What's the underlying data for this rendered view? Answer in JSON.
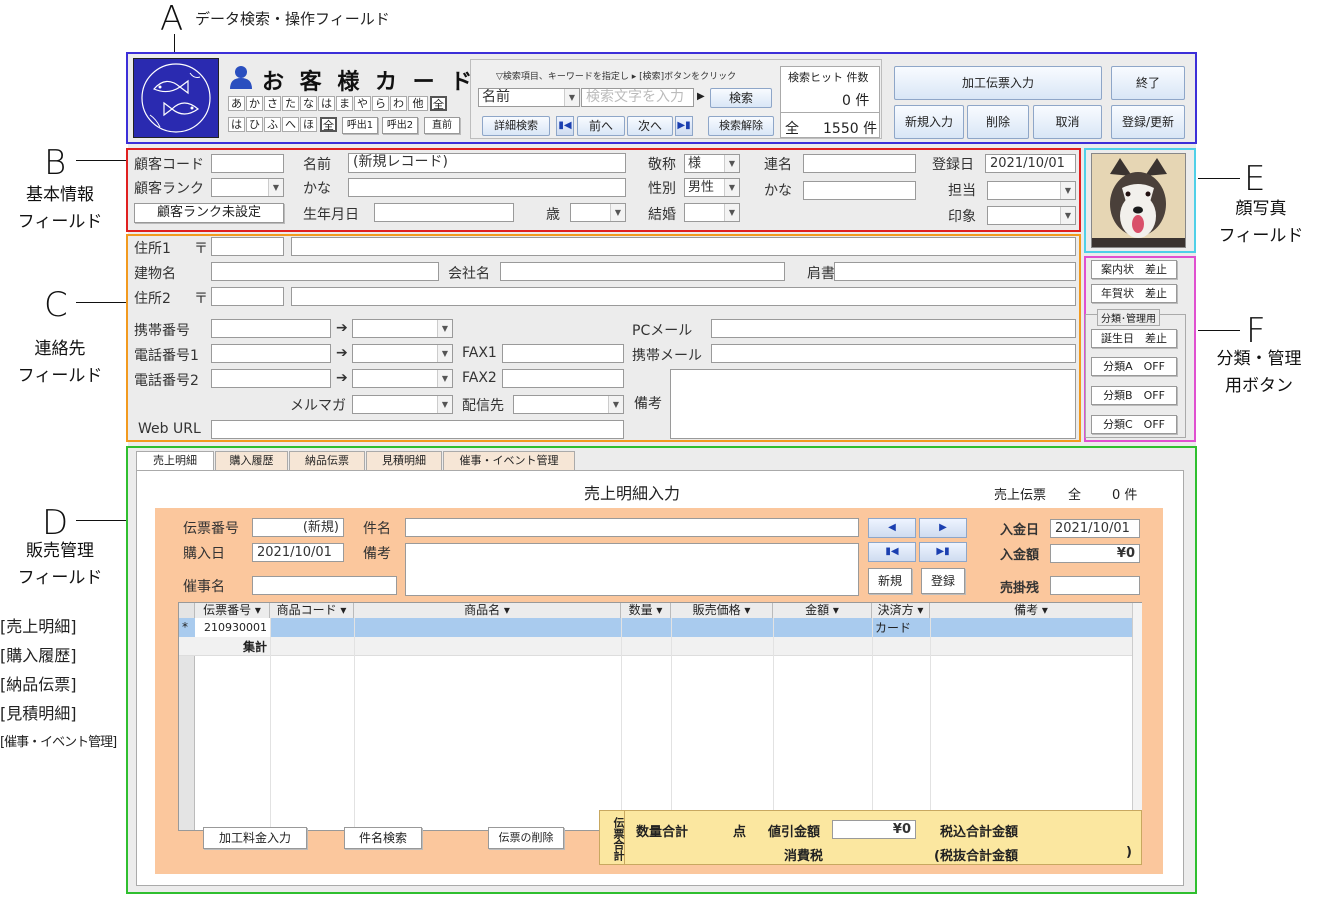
{
  "annotations": {
    "a_letter": "A",
    "a_text": "データ検索・操作フィールド",
    "b_letter": "B",
    "b_line1": "基本情報",
    "b_line2": "フィールド",
    "c_letter": "C",
    "c_line1": "連絡先",
    "c_line2": "フィールド",
    "d_letter": "D",
    "d_line1": "販売管理",
    "d_line2": "フィールド",
    "d_tabs": [
      "[売上明細]",
      "[購入履歴]",
      "[納品伝票]",
      "[見積明細]",
      "[催事・イベント管理]"
    ],
    "e_letter": "E",
    "e_line1": "顔写真",
    "e_line2": "フィールド",
    "f_letter": "F",
    "f_line1": "分類・管理",
    "f_line2": "用ボタン"
  },
  "colors": {
    "zone_a": "#3c2fd8",
    "zone_b": "#e02020",
    "zone_c": "#f29a1f",
    "zone_d": "#2fbf2f",
    "zone_e": "#4fd0e8",
    "zone_f": "#e050d0",
    "panel_orange": "#fbc79d",
    "logo_blue": "#2a2ab0"
  },
  "header": {
    "title": "お 客 様 カ ー ド",
    "kana_row1": [
      "あ",
      "か",
      "さ",
      "た",
      "な",
      "は",
      "ま",
      "や",
      "ら",
      "わ",
      "他",
      "全"
    ],
    "kana_row2": [
      "は",
      "ひ",
      "ふ",
      "へ",
      "ほ",
      "全"
    ],
    "call1": "呼出1",
    "call2": "呼出2",
    "prev_call": "直前",
    "hint": "▽検索項目、キーワードを指定し ▸ [検索]ボタンをクリック",
    "field_select": "名前",
    "search_placeholder": "検索文字を入力",
    "search_btn": "検索",
    "detail_search": "詳細検索",
    "prev": "前へ",
    "next": "次へ",
    "clear_search": "検索解除",
    "hit_label": "検索ヒット 件数",
    "hit_count": "0 件",
    "total_label": "全",
    "total_count": "1550 件",
    "btn_process": "加工伝票入力",
    "btn_exit": "終了",
    "btn_new": "新規入力",
    "btn_delete": "削除",
    "btn_cancel": "取消",
    "btn_save": "登録/更新"
  },
  "basic": {
    "customer_code": "顧客コード",
    "name": "名前",
    "name_value": "(新規レコード)",
    "honorific": "敬称",
    "honorific_value": "様",
    "joint": "連名",
    "reg_date": "登録日",
    "reg_date_value": "2021/10/01",
    "rank": "顧客ランク",
    "kana": "かな",
    "gender": "性別",
    "gender_value": "男性",
    "kana2": "かな",
    "staff": "担当",
    "rank_unset": "顧客ランク未設定",
    "birthday": "生年月日",
    "age": "歳",
    "marriage": "結婚",
    "impression": "印象"
  },
  "contact": {
    "address1": "住所1",
    "postal_mark1": "〒",
    "building": "建物名",
    "company": "会社名",
    "title": "肩書",
    "address2": "住所2",
    "postal_mark2": "〒",
    "mobile": "携帯番号",
    "phone1": "電話番号1",
    "phone2": "電話番号2",
    "fax1": "FAX1",
    "fax2": "FAX2",
    "pc_mail": "PCメール",
    "mobile_mail": "携帯メール",
    "mail_magazine": "メルマガ",
    "delivery": "配信先",
    "notes": "備考",
    "web_url": "Web URL",
    "arrow": "➔"
  },
  "photo_buttons": {
    "guide_stop": "案内状　差止",
    "newyear_stop": "年賀状　差止",
    "group_label": "分類･管理用",
    "birthday_stop": "誕生日　差止",
    "cat_a": "分類A　OFF",
    "cat_b": "分類B　OFF",
    "cat_c": "分類C　OFF"
  },
  "sales": {
    "tabs": [
      "売上明細",
      "購入履歴",
      "納品伝票",
      "見積明細",
      "催事・イベント管理"
    ],
    "heading": "売上明細入力",
    "slip_label": "売上伝票",
    "slip_all": "全",
    "slip_count": "0 件",
    "slip_no": "伝票番号",
    "slip_no_value": "(新規)",
    "item_name": "件名",
    "purchase_date": "購入日",
    "purchase_date_value": "2021/10/01",
    "remarks": "備考",
    "event_name": "催事名",
    "new_btn": "新規",
    "reg_btn": "登録",
    "pay_date": "入金日",
    "pay_date_value": "2021/10/01",
    "pay_amount": "入金額",
    "pay_amount_value": "¥0",
    "receivable": "売掛残",
    "columns": [
      "伝票番号",
      "商品コード",
      "商品名",
      "数量",
      "販売価格",
      "金額",
      "決済方",
      "備考"
    ],
    "row_marker": "*",
    "row_slip_no": "210930001",
    "row_payment": "カード",
    "total_row": "集計",
    "btn_processing_fee": "加工料金入力",
    "btn_item_search": "件名検索",
    "btn_delete_slip": "伝票の削除",
    "summary_side": "伝票合計",
    "qty_total": "数量合計",
    "qty_unit": "点",
    "discount": "値引金額",
    "discount_value": "¥0",
    "tax_incl_total": "税込合計金額",
    "consumption_tax": "消費税",
    "tax_excl_total": "(税抜合計金額",
    "close_paren": ")"
  }
}
